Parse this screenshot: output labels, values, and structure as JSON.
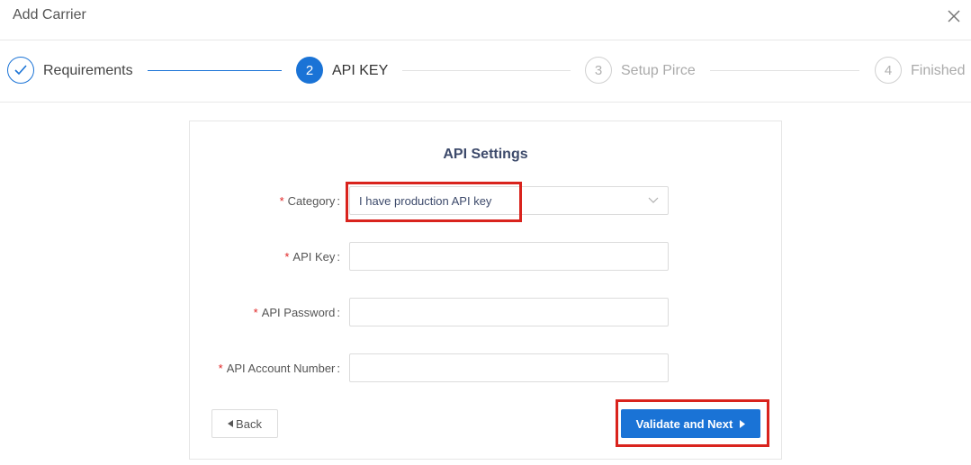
{
  "dialog": {
    "title": "Add Carrier",
    "close_icon": "close-icon"
  },
  "steps": [
    {
      "number": "1",
      "label": "Requirements",
      "status": "done"
    },
    {
      "number": "2",
      "label": "API KEY",
      "status": "active"
    },
    {
      "number": "3",
      "label": "Setup Pirce",
      "status": "todo"
    },
    {
      "number": "4",
      "label": "Finished",
      "status": "todo"
    }
  ],
  "form": {
    "title": "API Settings",
    "required_mark": "*",
    "colon": ":",
    "fields": {
      "category": {
        "label": "Category",
        "value": "I have production API key"
      },
      "api_key": {
        "label": "API Key",
        "value": ""
      },
      "api_password": {
        "label": "API Password",
        "value": ""
      },
      "api_account_number": {
        "label": "API Account Number",
        "value": ""
      }
    },
    "back_label": "Back",
    "next_label": "Validate and Next"
  },
  "colors": {
    "accent": "#1a73d6",
    "highlight": "#d9231d",
    "required": "#e02424"
  }
}
